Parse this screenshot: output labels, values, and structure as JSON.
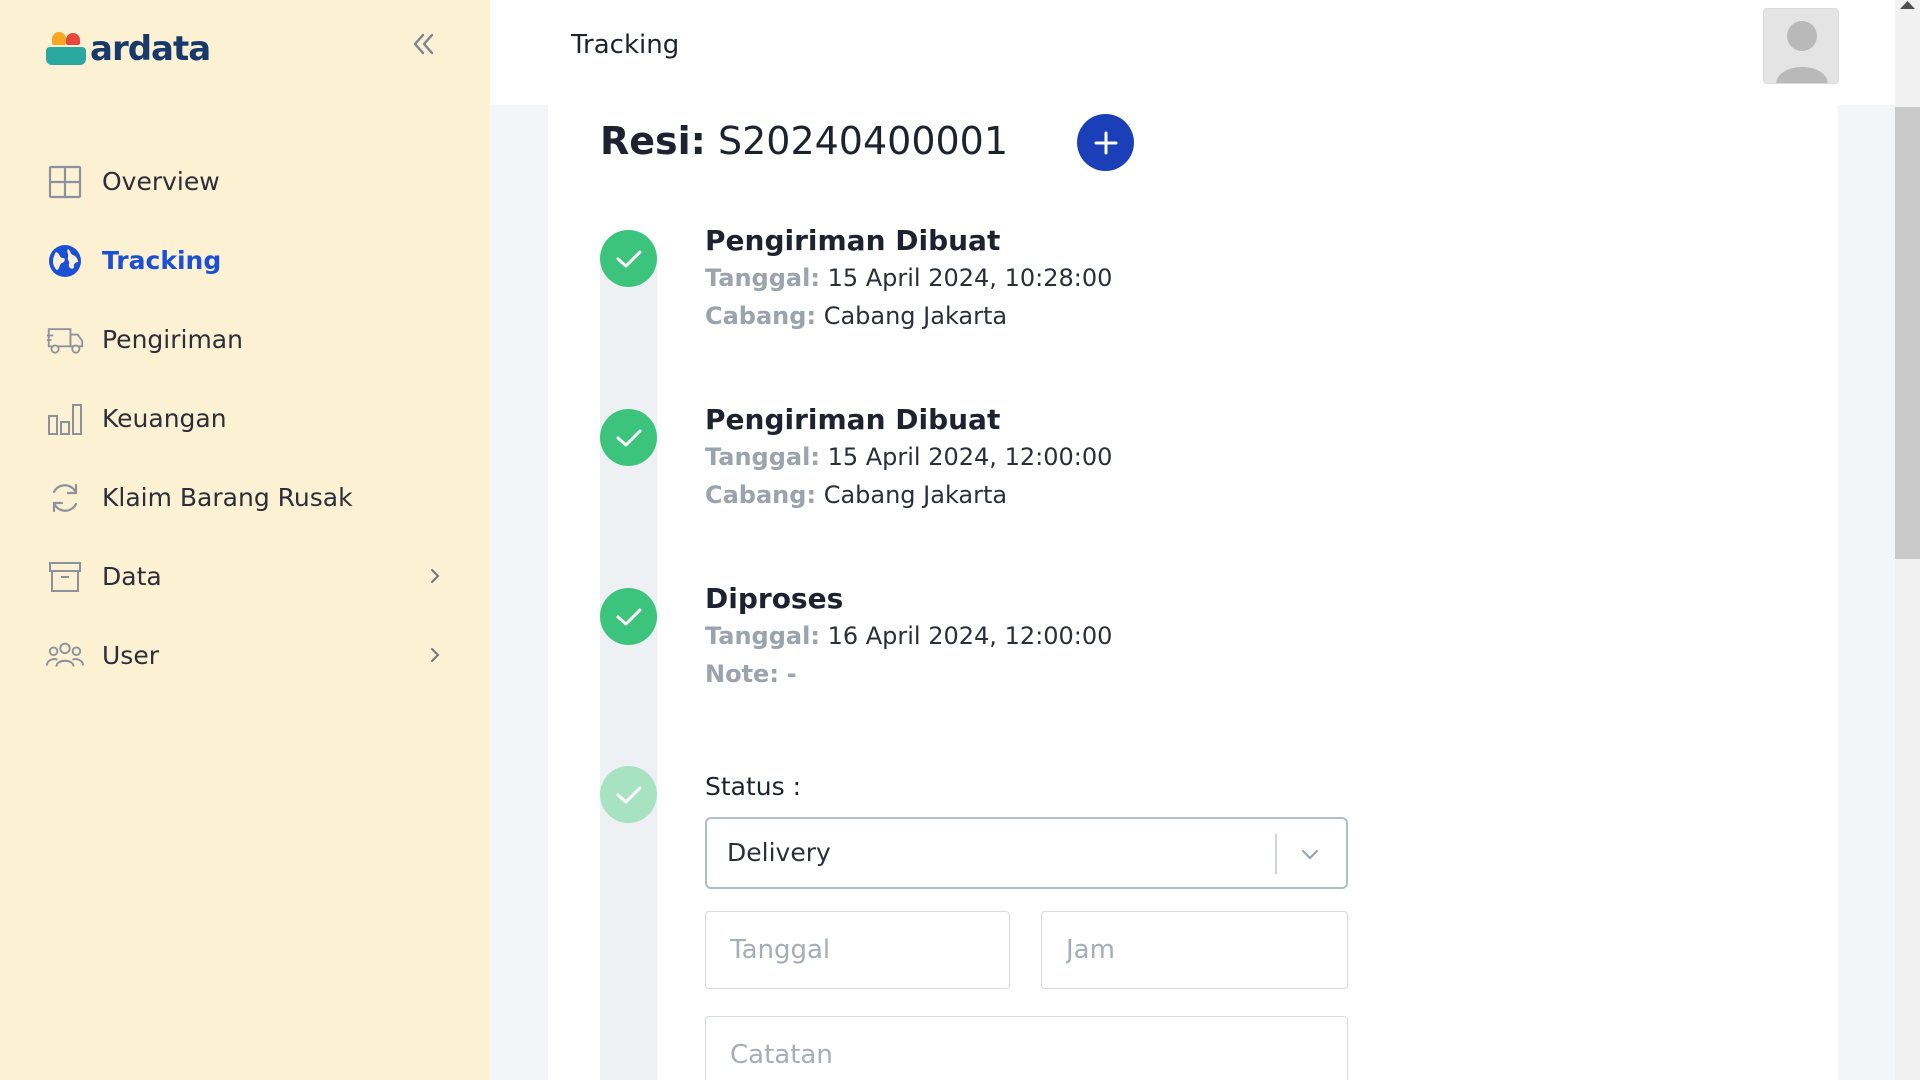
{
  "brand": {
    "name": "ardata"
  },
  "sidebar": {
    "items": [
      {
        "label": "Overview",
        "icon": "grid-icon",
        "active": false
      },
      {
        "label": "Tracking",
        "icon": "globe-icon",
        "active": true
      },
      {
        "label": "Pengiriman",
        "icon": "truck-icon",
        "active": false
      },
      {
        "label": "Keuangan",
        "icon": "bar-chart-icon",
        "active": false
      },
      {
        "label": "Klaim Barang Rusak",
        "icon": "refresh-icon",
        "active": false
      },
      {
        "label": "Data",
        "icon": "archive-icon",
        "active": false,
        "has_submenu": true
      },
      {
        "label": "User",
        "icon": "users-icon",
        "active": false,
        "has_submenu": true
      }
    ]
  },
  "header": {
    "title": "Tracking"
  },
  "shipment": {
    "resi_label": "Resi:",
    "resi_number": "S20240400001"
  },
  "timeline": [
    {
      "title": "Pengiriman Dibuat",
      "date_key": "Tanggal:",
      "date_value": "15 April 2024, 10:28:00",
      "extra_key": "Cabang:",
      "extra_value": "Cabang Jakarta"
    },
    {
      "title": "Pengiriman Dibuat",
      "date_key": "Tanggal:",
      "date_value": "15 April 2024, 12:00:00",
      "extra_key": "Cabang:",
      "extra_value": "Cabang Jakarta"
    },
    {
      "title": "Diproses",
      "date_key": "Tanggal:",
      "date_value": "16 April 2024, 12:00:00",
      "extra_key": "Note:",
      "extra_value": "-"
    }
  ],
  "form": {
    "status_label": "Status :",
    "status_value": "Delivery",
    "date_placeholder": "Tanggal",
    "time_placeholder": "Jam",
    "note_placeholder": "Catatan"
  },
  "colors": {
    "sidebar_bg": "#fdf1d4",
    "accent_blue": "#1b4fd6",
    "add_button": "#1b3fb8",
    "done_green": "#3cc47c",
    "pending_green": "#a7e3c2"
  }
}
